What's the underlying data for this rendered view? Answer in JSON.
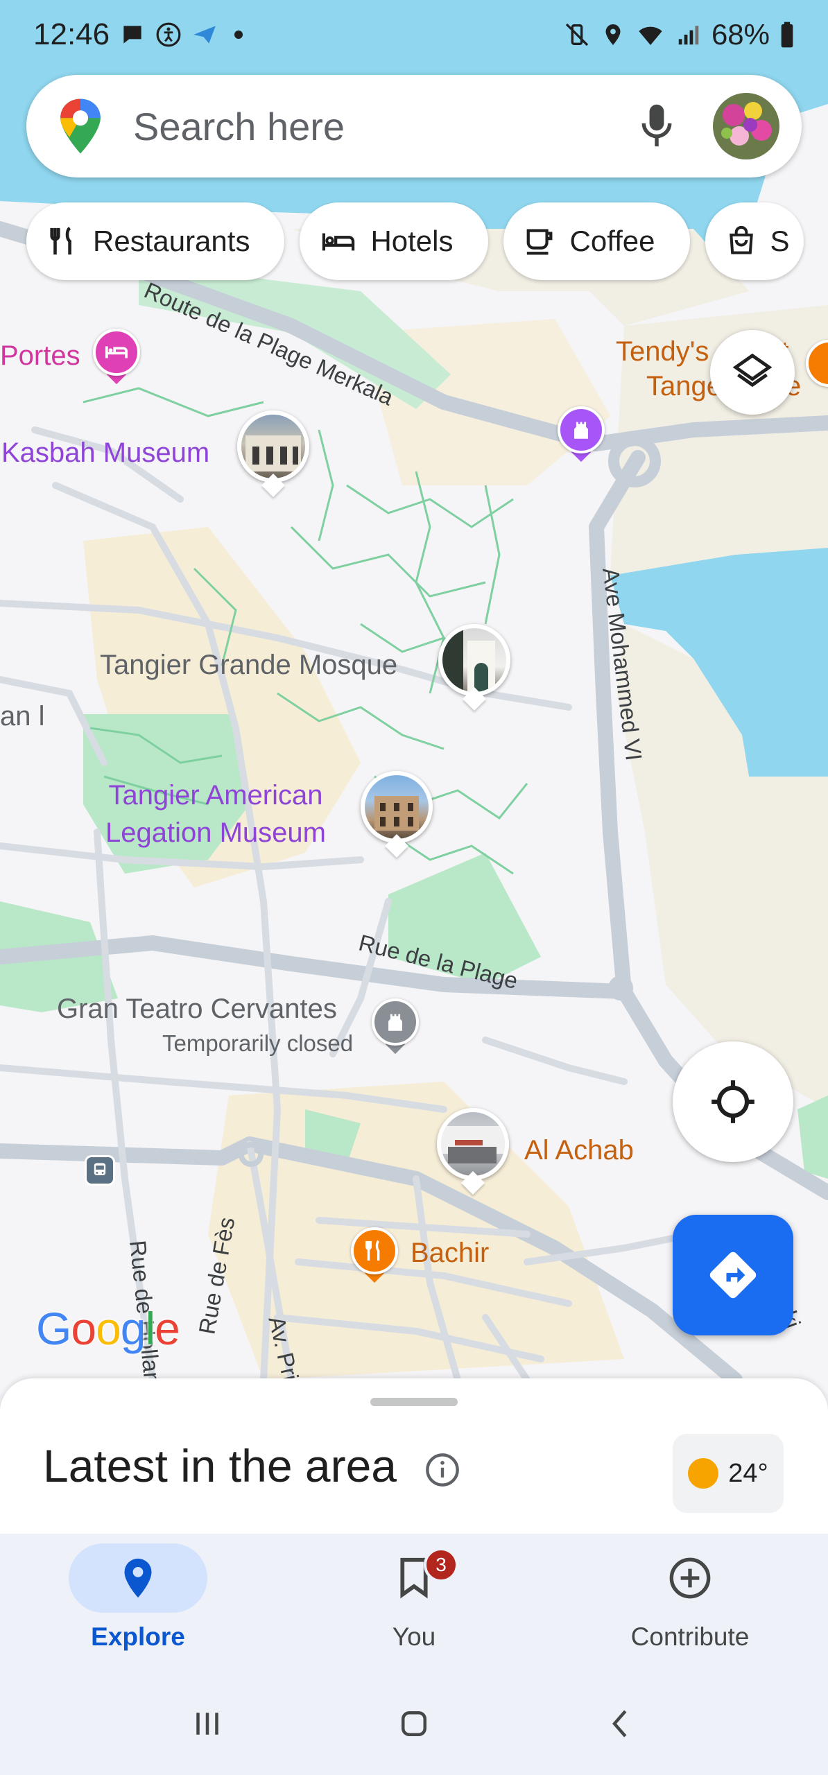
{
  "status_bar": {
    "time": "12:46",
    "battery": "68%"
  },
  "search": {
    "placeholder": "Search here"
  },
  "chips": [
    {
      "label": "Restaurants",
      "icon": "fork-knife-icon"
    },
    {
      "label": "Hotels",
      "icon": "bed-icon"
    },
    {
      "label": "Coffee",
      "icon": "coffee-cup-icon"
    },
    {
      "label": "S",
      "icon": "shopping-bag-icon"
    }
  ],
  "map": {
    "places": {
      "portes": "Portes",
      "kasbah": "Kasbah Museum",
      "mosque": "Tangier Grande Mosque",
      "legation_line1": "Tangier American",
      "legation_line2": "Legation Museum",
      "teatro": "Gran Teatro Cervantes",
      "teatro_status": "Temporarily closed",
      "achab": "Al Achab",
      "bachir": "Bachir",
      "tendys_line1": "Tendy's",
      "tendys_line1b": "t",
      "tendys_line2": "Tange",
      "tendys_line2b": "e",
      "partial_left": "an l"
    },
    "streets": {
      "merkala": "Route de la Plage Merkala",
      "mohammed": "Ave Mohammed VI",
      "plage": "Rue de la Plage",
      "fes": "Rue de Fès",
      "hollande": "Rue de Hollande",
      "av_pri": "Av. Pri",
      "ataki": "ataki"
    },
    "logo": "Google"
  },
  "bottom_sheet": {
    "title": "Latest in the area",
    "temperature": "24°"
  },
  "bottom_nav": {
    "explore": "Explore",
    "you": "You",
    "you_badge": "3",
    "contribute": "Contribute"
  },
  "colors": {
    "accent_blue": "#1a6cf0",
    "purple_poi": "#8e44d6",
    "orange_poi": "#c5600f",
    "water": "#8fd6ee",
    "park": "#b9e8c8"
  }
}
